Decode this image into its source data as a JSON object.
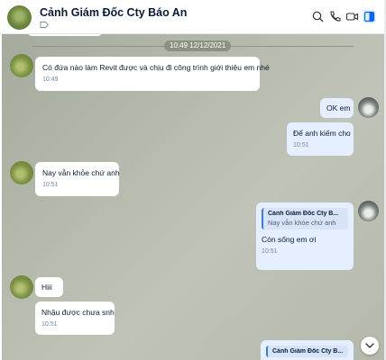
{
  "header": {
    "title": "Cảnh Giám Đốc Cty Báo An",
    "icons": [
      "search-icon",
      "phone-icon",
      "video-call-icon",
      "sidebar-toggle-icon"
    ]
  },
  "chat": {
    "date_divider": "10:49 12/12/2021",
    "messages": [
      {
        "text": "Có đứa nào làm Revit được và chịu đi công trình giới thiệu em nhé",
        "time": "10:49"
      },
      {
        "text": "OK em"
      },
      {
        "text": "Để anh kiếm cho",
        "time": "10:51"
      },
      {
        "text": "Nay vẫn khỏe chứ anh",
        "time": "10:51"
      },
      {
        "quote_name": "Cảnh Giám Đốc Cty B...",
        "quote_text": "Nay vẫn khỏe chứ anh",
        "text": "Còn sống em ơi",
        "time": "10:51"
      },
      {
        "text": "Hiii"
      },
      {
        "text": "Nhậu được chưa snh",
        "time": "10:51"
      },
      {
        "quote_name": "Cảnh Giám Đốc Cty B..."
      }
    ]
  },
  "colors": {
    "accent": "#0068ff",
    "outgoing_bubble": "#e5efff",
    "incoming_bubble": "#ffffff"
  }
}
